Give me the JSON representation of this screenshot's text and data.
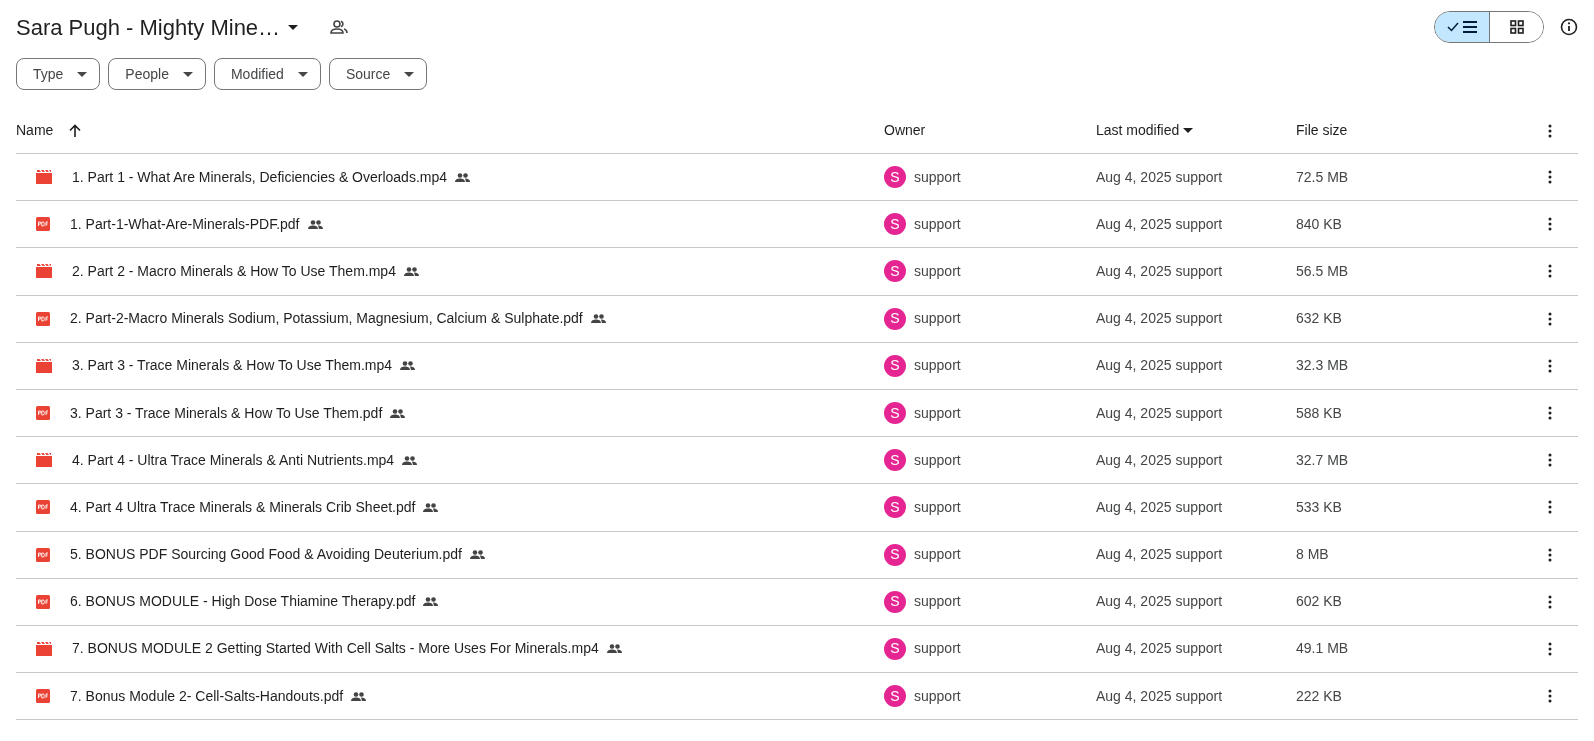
{
  "header": {
    "title": "Sara Pugh - Mighty Mine…"
  },
  "view_toggle": [
    {
      "kind": "list",
      "selected": true
    },
    {
      "kind": "grid",
      "selected": false
    }
  ],
  "filters": [
    {
      "label": "Type"
    },
    {
      "label": "People"
    },
    {
      "label": "Modified"
    },
    {
      "label": "Source"
    }
  ],
  "table": {
    "columns": [
      {
        "label": "Name",
        "kind": "sort-asc"
      },
      {
        "label": "Owner",
        "kind": "plain"
      },
      {
        "label": "Last modified",
        "kind": "dropdown"
      },
      {
        "label": "File size",
        "kind": "plain"
      }
    ],
    "rows": [
      {
        "kind": "video",
        "name": "1. Part 1 - What Are Minerals, Deficiencies & Overloads.mp4",
        "avatar": "S",
        "owner": "support",
        "modified": "Aug 4, 2025 support",
        "size": "72.5 MB"
      },
      {
        "kind": "pdf",
        "name": "1. Part-1-What-Are-Minerals-PDF.pdf",
        "avatar": "S",
        "owner": "support",
        "modified": "Aug 4, 2025 support",
        "size": "840 KB"
      },
      {
        "kind": "video",
        "name": "2. Part 2 - Macro Minerals & How To Use Them.mp4",
        "avatar": "S",
        "owner": "support",
        "modified": "Aug 4, 2025 support",
        "size": "56.5 MB"
      },
      {
        "kind": "pdf",
        "name": "2. Part-2-Macro Minerals Sodium, Potassium, Magnesium, Calcium & Sulphate.pdf",
        "avatar": "S",
        "owner": "support",
        "modified": "Aug 4, 2025 support",
        "size": "632 KB"
      },
      {
        "kind": "video",
        "name": "3. Part 3 - Trace Minerals & How To Use Them.mp4",
        "avatar": "S",
        "owner": "support",
        "modified": "Aug 4, 2025 support",
        "size": "32.3 MB"
      },
      {
        "kind": "pdf",
        "name": "3. Part 3 - Trace Minerals & How To Use Them.pdf",
        "avatar": "S",
        "owner": "support",
        "modified": "Aug 4, 2025 support",
        "size": "588 KB"
      },
      {
        "kind": "video",
        "name": "4. Part 4 - Ultra Trace Minerals & Anti Nutrients.mp4",
        "avatar": "S",
        "owner": "support",
        "modified": "Aug 4, 2025 support",
        "size": "32.7 MB"
      },
      {
        "kind": "pdf",
        "name": "4. Part 4 Ultra Trace Minerals & Minerals Crib Sheet.pdf",
        "avatar": "S",
        "owner": "support",
        "modified": "Aug 4, 2025 support",
        "size": "533 KB"
      },
      {
        "kind": "pdf",
        "name": "5. BONUS PDF Sourcing Good Food & Avoiding Deuterium.pdf",
        "avatar": "S",
        "owner": "support",
        "modified": "Aug 4, 2025 support",
        "size": "8 MB"
      },
      {
        "kind": "pdf",
        "name": "6. BONUS MODULE - High Dose Thiamine Therapy.pdf",
        "avatar": "S",
        "owner": "support",
        "modified": "Aug 4, 2025 support",
        "size": "602 KB"
      },
      {
        "kind": "video",
        "name": "7. BONUS MODULE 2 Getting Started With Cell Salts - More Uses For Minerals.mp4",
        "avatar": "S",
        "owner": "support",
        "modified": "Aug 4, 2025 support",
        "size": "49.1 MB"
      },
      {
        "kind": "pdf",
        "name": "7. Bonus Module 2- Cell-Salts-Handouts.pdf",
        "avatar": "S",
        "owner": "support",
        "modified": "Aug 4, 2025 support",
        "size": "222 KB"
      }
    ]
  }
}
